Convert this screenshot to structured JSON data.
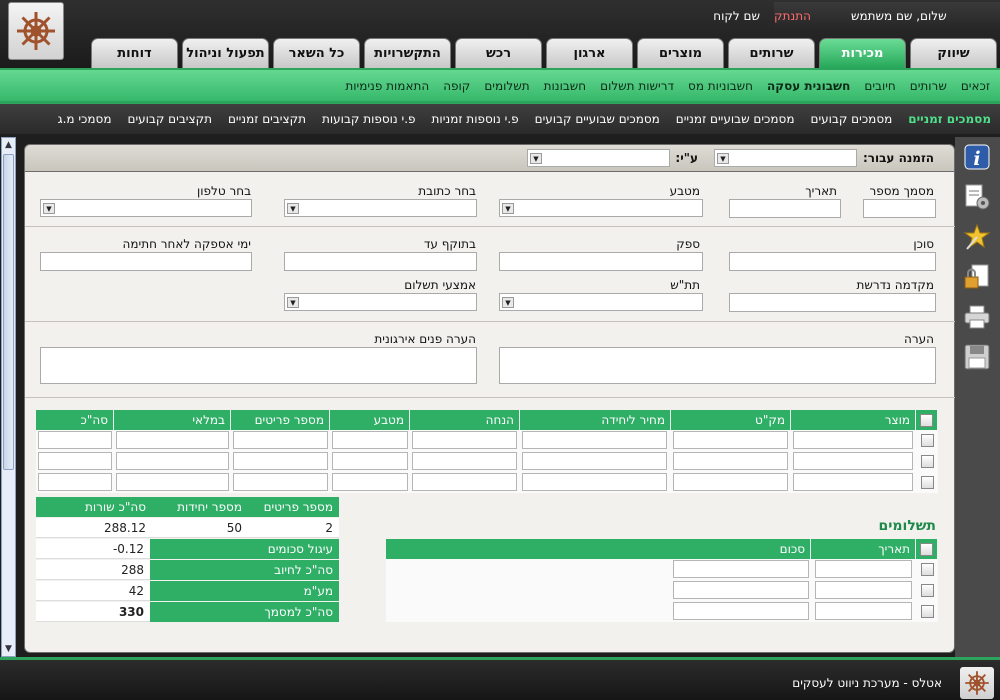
{
  "header": {
    "greeting": "שלום, שם משתמש",
    "logout": "התנתק",
    "customer": "שם לקוח"
  },
  "tabs": [
    "שיווק",
    "מכירות",
    "שרותים",
    "מוצרים",
    "ארגון",
    "רכש",
    "התקשרויות",
    "כל השאר",
    "תפעול וניהול",
    "דוחות"
  ],
  "active_tab": "מכירות",
  "subnav": [
    "זכאים",
    "שרותים",
    "חיובים",
    "חשבונית עסקה",
    "חשבוניות מס",
    "דרישות תשלום",
    "חשבונות",
    "תשלומים",
    "קופה",
    "התאמות פנימיות"
  ],
  "subnav_active": "חשבונית עסקה",
  "subnav2": [
    "מסמכים זמניים",
    "מסמכים קבועים",
    "מסמכים שבועיים זמניים",
    "מסמכים שבועיים קבועים",
    "פ.י נוספות זמניות",
    "פ.י נוספות קבועות",
    "תקציבים זמניים",
    "תקציבים קבועים",
    "מסמכי מ.ג"
  ],
  "subnav2_active": "מסמכים זמניים",
  "form": {
    "order_for": "הזמנה עבור:",
    "by": "ע\"י:",
    "doc_no": "מסמך מספר",
    "date": "תאריך",
    "currency": "מטבע",
    "address": "בחר כתובת",
    "phone": "בחר טלפון",
    "agent": "סוכן",
    "supplier": "ספק",
    "valid_until": "בתוקף עד",
    "supply_days": "ימי אספקה לאחר חתימה",
    "advance": "מקדמה נדרשת",
    "subtotal": "תת\"ש",
    "payment_method": "אמצעי תשלום",
    "remark": "הערה",
    "internal_remark": "הערה פנים אירגונית"
  },
  "items": {
    "columns": [
      "מוצר",
      "מק\"ט",
      "מחיר ליחידה",
      "הנחה",
      "מטבע",
      "מספר פריטים",
      "במלאי",
      "סה\"כ"
    ]
  },
  "payments": {
    "title": "תשלומים",
    "columns": [
      "תאריך",
      "סכום"
    ]
  },
  "summary": {
    "headers": [
      "מספר פריטים",
      "מספר יחידות",
      "סה\"כ שורות"
    ],
    "values": [
      "2",
      "50",
      "288.12"
    ],
    "rows": [
      {
        "label": "עיגול סכומים",
        "value": "-0.12"
      },
      {
        "label": "סה\"כ לחיוב",
        "value": "288"
      },
      {
        "label": "מע\"מ",
        "value": "42"
      },
      {
        "label": "סה\"כ למסמך",
        "value": "330"
      }
    ]
  },
  "footer": "אטלס - מערכת ניווט לעסקים"
}
